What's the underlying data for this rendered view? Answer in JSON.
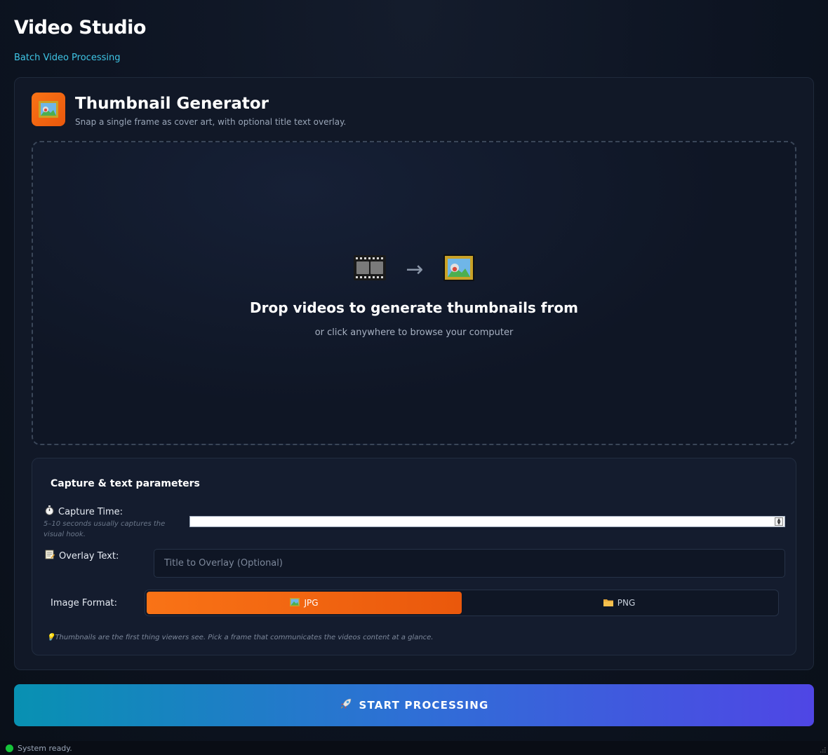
{
  "app": {
    "title": "Video Studio",
    "subtitle": "Batch Video Processing"
  },
  "tool": {
    "icon": "picture-icon",
    "title": "Thumbnail Generator",
    "description": "Snap a single frame as cover art, with optional title text overlay."
  },
  "dropzone": {
    "icons": [
      "film-icon",
      "arrow-right-icon",
      "picture-icon"
    ],
    "arrow": "→",
    "title": "Drop videos to generate thumbnails from",
    "hint": "or click anywhere to browse your computer"
  },
  "params": {
    "title": "Capture & text parameters",
    "capture_time": {
      "icon": "stopwatch-icon",
      "label": "Capture Time:",
      "hint": "5–10 seconds usually captures the visual hook.",
      "value": ""
    },
    "overlay_text": {
      "icon": "memo-icon",
      "label": "Overlay Text:",
      "placeholder": "Title to Overlay (Optional)",
      "value": ""
    },
    "image_format": {
      "label": "Image Format:",
      "options": [
        {
          "label": "JPG",
          "icon": "picture-icon",
          "selected": true
        },
        {
          "label": "PNG",
          "icon": "folder-icon",
          "selected": false
        }
      ]
    },
    "tip": "Thumbnails are the first thing viewers see. Pick a frame that communicates the videos content at a glance."
  },
  "start_button": {
    "icon": "rocket-icon",
    "label": "START PROCESSING"
  },
  "status": {
    "text": "System ready.",
    "color": "#16c43a"
  },
  "colors": {
    "accent_orange": "#f97316",
    "accent_cyan": "#3fc6e6",
    "button_gradient_start": "#0891b2",
    "button_gradient_end": "#4f46e5"
  }
}
